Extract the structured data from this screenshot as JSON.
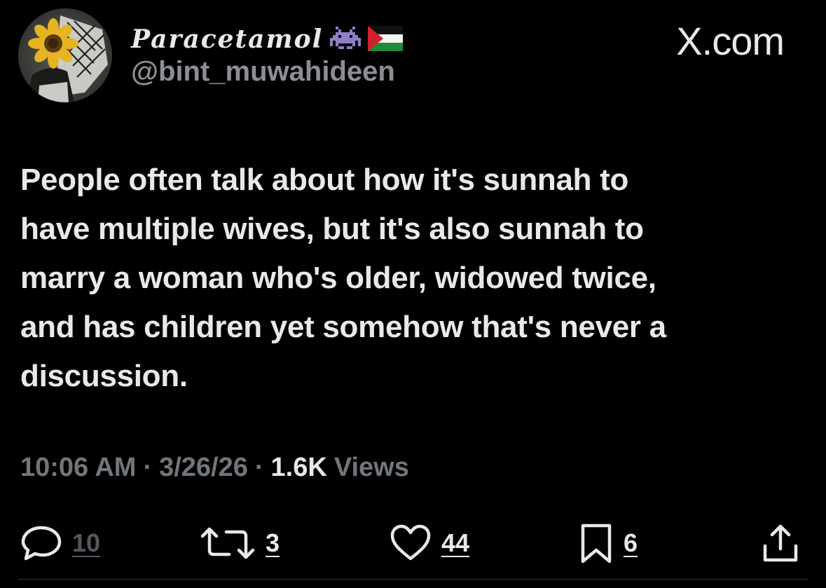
{
  "author": {
    "display_name": "Paracetamol",
    "handle": "@bint_muwahideen",
    "name_emojis": [
      "alien-monster-icon",
      "palestine-flag-icon"
    ]
  },
  "brand": {
    "label": "X.com"
  },
  "tweet": {
    "lines": [
      "People often talk about how it's sunnah to",
      "have multiple wives, but it's also sunnah to",
      "marry a woman who's older, widowed twice,",
      "and has children yet somehow that's never a",
      "discussion."
    ]
  },
  "meta": {
    "time": "10:06 AM",
    "separator": "·",
    "date": "3/26/26",
    "views_count": "1.6K",
    "views_label": "Views"
  },
  "actions": {
    "replies": "10",
    "reposts": "3",
    "likes": "44",
    "bookmarks": "6"
  },
  "colors": {
    "background": "#000000",
    "text_primary": "#e7e9ea",
    "text_secondary": "#71767b",
    "handle": "#8b8f94",
    "reply_dim": "#55595e",
    "divider": "#2f3336"
  }
}
